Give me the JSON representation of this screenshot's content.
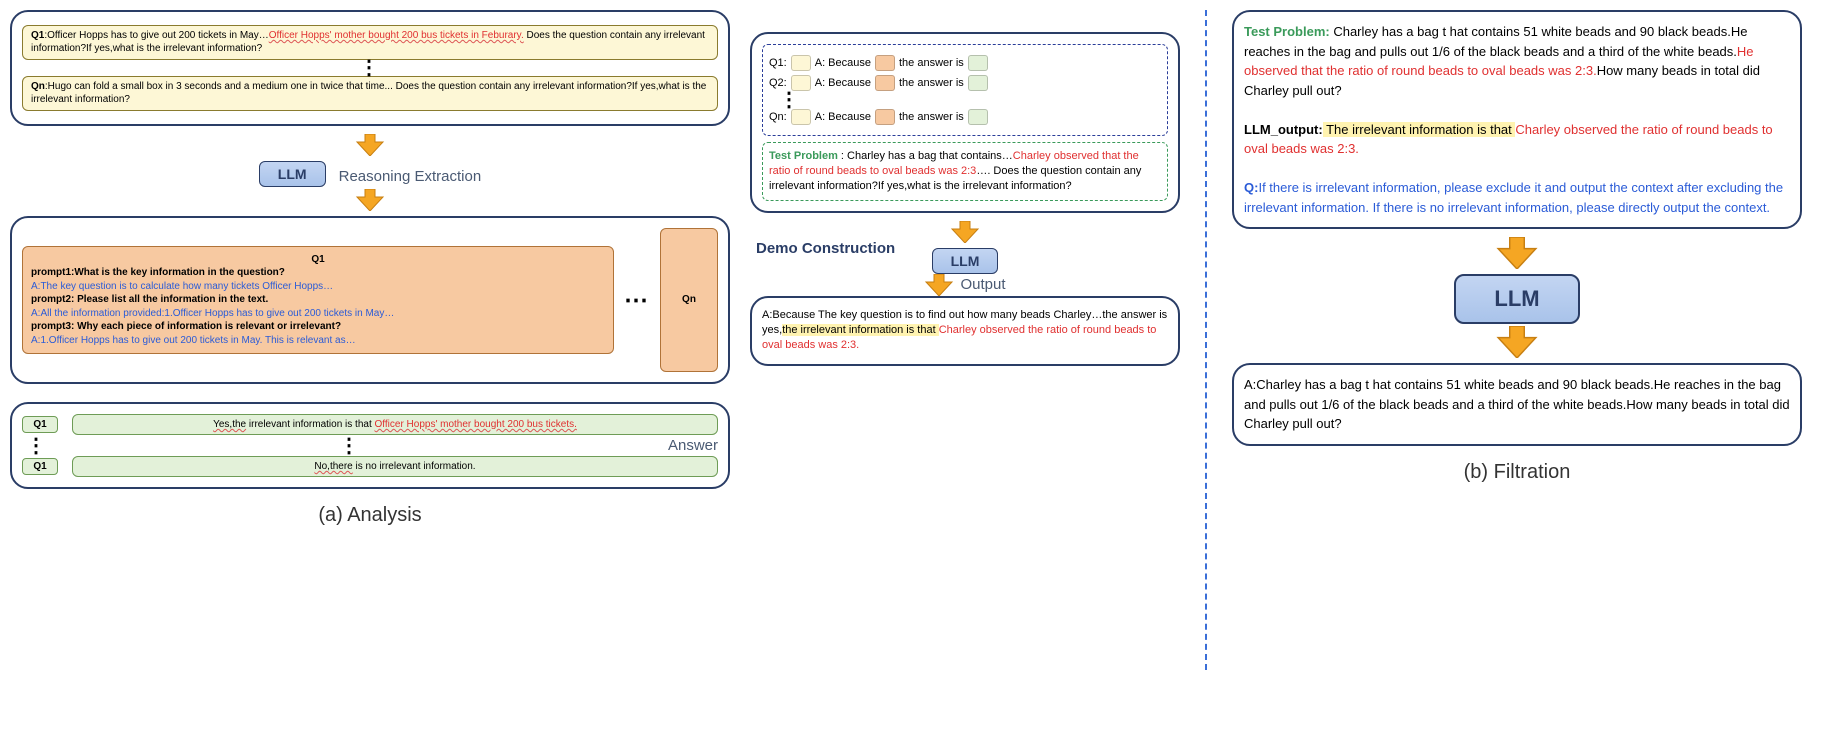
{
  "analysis": {
    "q1_label": "Q1",
    "q1_text_pre": ":Officer Hopps has to give out 200 tickets in May…",
    "q1_text_red": "Officer Hopps' mother bought 200 bus tickets in Feburary.",
    "q1_text_post": " Does the question contain any irrelevant information?If yes,what is the irrelevant information?",
    "qn_label": "Qn",
    "qn_text": ":Hugo can fold a small box in 3 seconds and a medium one in twice that time... Does the question contain any irrelevant information?If yes,what is the irrelevant information?",
    "llm_label": "LLM",
    "reasoning_label": "Reasoning Extraction",
    "q1_card_label": "Q1",
    "qn_card_label": "Qn",
    "prompt1_label": "prompt1:What is the key information in the question?",
    "prompt1_ans": "A:The key question is to calculate how many tickets Officer Hopps…",
    "prompt2_label": "prompt2: Please list all the information in the text.",
    "prompt2_ans": "A:All the information provided:1.Officer Hopps has to give out 200 tickets in May…",
    "prompt3_label": "prompt3: Why each piece of information is relevant or irrelevant?",
    "prompt3_ans": "A:1.Officer Hopps has to give out 200 tickets in May. This is relevant as…",
    "answer_label": "Answer",
    "ans_q_left1": "Q1",
    "ans_q_left2": "Q1",
    "ans1_pre": "Yes,the",
    "ans1_mid": " irrelevant information is that ",
    "ans1_red": "Officer Hopps' mother bought 200 bus tickets.",
    "ans2_pre": "No,there",
    "ans2_post": " is no irrelevant information.",
    "caption": "(a) Analysis"
  },
  "demo": {
    "demo_label": "Demo Construction",
    "line_q1": "Q1:",
    "line_q2": "Q2:",
    "line_qn": "Qn:",
    "a_because": "A: Because",
    "the_answer_is": "the answer is",
    "test_problem_label": "Test Problem",
    "test_problem_text_pre": " : Charley has a bag that contains…",
    "test_problem_text_red": "Charley observed that the ratio of round beads to oval beads was 2:3",
    "test_problem_text_post": "…. Does the question contain any irrelevant information?If yes,what is the irrelevant information?",
    "llm_label": "LLM",
    "output_label": "Output",
    "out_pre": "A:Because The key question is to find out how many beads Charley…the answer is yes,",
    "out_hl": "the irrelevant information is that ",
    "out_red": "Charley observed the ratio of round beads to oval beads was 2:3."
  },
  "filtration": {
    "test_problem_label": "Test Problem:",
    "tp_text_pre": " Charley has a bag t hat contains 51 white beads and 90 black beads.He reaches in the bag and pulls out 1/6 of the black beads and a third of the white beads.",
    "tp_text_red": "He observed that the ratio of round beads to oval beads was 2:3.",
    "tp_text_post": "How many beads in total did Charley pull out?",
    "llm_output_label": "LLM_output:",
    "llm_out_hl": " The irrelevant information is that ",
    "llm_out_red": "Charley observed the ratio of round beads to oval beads was 2:3.",
    "q_label": "Q:",
    "q_text": "If there is irrelevant information, please exclude it and output the context after excluding the irrelevant information. If there is no irrelevant information, please directly output the context.",
    "llm_label": "LLM",
    "final_answer": "A:Charley has a bag t hat contains 51 white beads and 90 black beads.He reaches in the bag and pulls out 1/6 of the black beads and a third of the white beads.How many beads in total did Charley pull out?",
    "caption": "(b) Filtration"
  }
}
